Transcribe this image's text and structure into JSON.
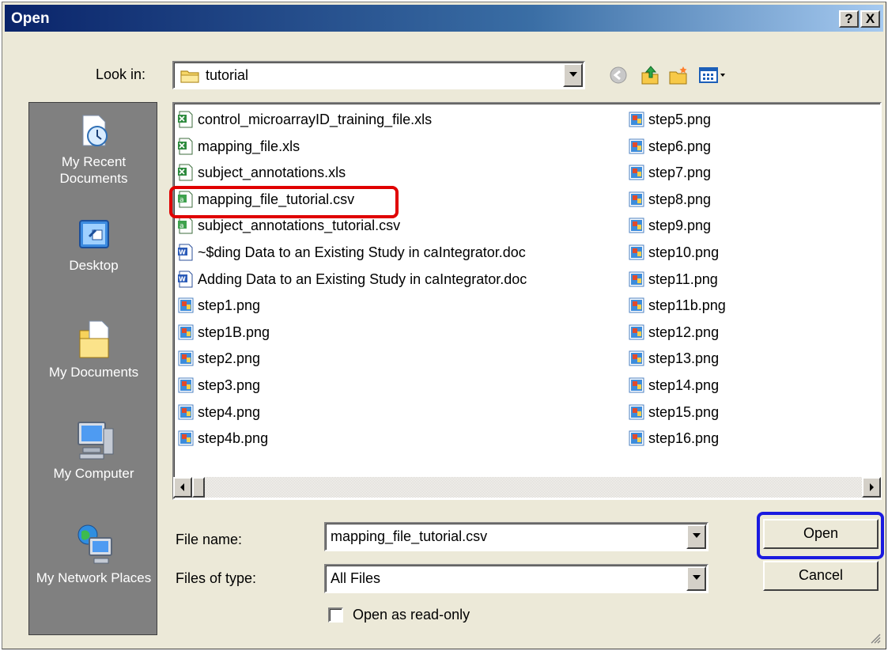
{
  "window": {
    "title": "Open",
    "help_label": "?",
    "close_label": "X"
  },
  "lookin": {
    "label": "Look in:",
    "value": "tutorial"
  },
  "toolbar": {
    "icons": [
      "back-icon",
      "up-folder-icon",
      "new-folder-icon",
      "view-menu-icon"
    ]
  },
  "places": [
    {
      "label": "My Recent Documents",
      "icon": "recent-documents-icon"
    },
    {
      "label": "Desktop",
      "icon": "desktop-icon"
    },
    {
      "label": "My Documents",
      "icon": "my-documents-icon"
    },
    {
      "label": "My Computer",
      "icon": "my-computer-icon"
    },
    {
      "label": "My Network Places",
      "icon": "network-places-icon"
    }
  ],
  "files_left": [
    {
      "name": "control_microarrayID_training_file.xls",
      "type": "xls"
    },
    {
      "name": "mapping_file.xls",
      "type": "xls"
    },
    {
      "name": "subject_annotations.xls",
      "type": "xls"
    },
    {
      "name": "mapping_file_tutorial.csv",
      "type": "csv"
    },
    {
      "name": "subject_annotations_tutorial.csv",
      "type": "csv"
    },
    {
      "name": "~$ding Data to an Existing Study in caIntegrator.doc",
      "type": "doc"
    },
    {
      "name": "Adding Data to an Existing Study in caIntegrator.doc",
      "type": "doc"
    },
    {
      "name": "step1.png",
      "type": "png"
    },
    {
      "name": "step1B.png",
      "type": "png"
    },
    {
      "name": "step2.png",
      "type": "png"
    },
    {
      "name": "step3.png",
      "type": "png"
    },
    {
      "name": "step4.png",
      "type": "png"
    },
    {
      "name": "step4b.png",
      "type": "png"
    }
  ],
  "files_right": [
    {
      "name": "step5.png",
      "type": "png"
    },
    {
      "name": "step6.png",
      "type": "png"
    },
    {
      "name": "step7.png",
      "type": "png"
    },
    {
      "name": "step8.png",
      "type": "png"
    },
    {
      "name": "step9.png",
      "type": "png"
    },
    {
      "name": "step10.png",
      "type": "png"
    },
    {
      "name": "step11.png",
      "type": "png"
    },
    {
      "name": "step11b.png",
      "type": "png"
    },
    {
      "name": "step12.png",
      "type": "png"
    },
    {
      "name": "step13.png",
      "type": "png"
    },
    {
      "name": "step14.png",
      "type": "png"
    },
    {
      "name": "step15.png",
      "type": "png"
    },
    {
      "name": "step16.png",
      "type": "png"
    }
  ],
  "filename": {
    "label": "File name:",
    "value": "mapping_file_tutorial.csv"
  },
  "filetype": {
    "label": "Files of type:",
    "value": "All Files"
  },
  "readonly": {
    "label": "Open as read-only",
    "checked": false
  },
  "buttons": {
    "open": "Open",
    "cancel": "Cancel"
  },
  "colors": {
    "title_gradient_start": "#0a246a",
    "title_gradient_end": "#a6caf0",
    "highlight_file": "#e00000",
    "highlight_button": "#1a1ae0"
  }
}
